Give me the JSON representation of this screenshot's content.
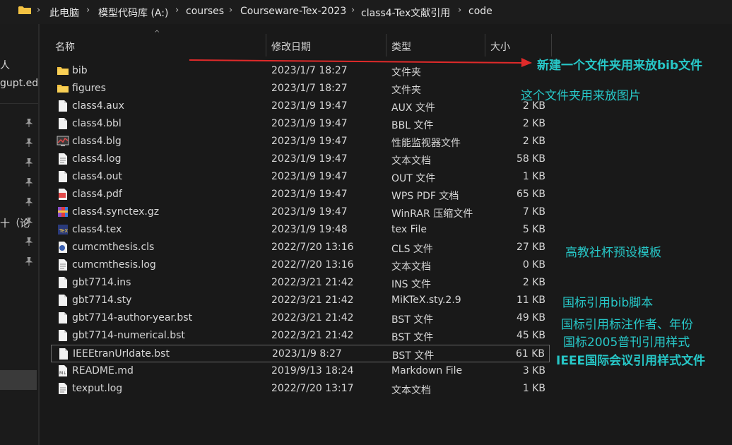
{
  "breadcrumb": [
    "此电脑",
    "模型代码库 (A:)",
    "courses",
    "Courseware-Tex-2023",
    "class4-Tex文献引用",
    "code"
  ],
  "left_pane": {
    "fragments": [
      "人",
      "gupt.edu",
      "十（论"
    ]
  },
  "columns": {
    "name": "名称",
    "date": "修改日期",
    "type": "类型",
    "size": "大小"
  },
  "files": [
    {
      "name": "bib",
      "date": "2023/1/7 18:27",
      "type": "文件夹",
      "size": "",
      "icon": "folder-icon"
    },
    {
      "name": "figures",
      "date": "2023/1/7 18:27",
      "type": "文件夹",
      "size": "",
      "icon": "folder-icon"
    },
    {
      "name": "class4.aux",
      "date": "2023/1/9 19:47",
      "type": "AUX 文件",
      "size": "2 KB",
      "icon": "file-icon"
    },
    {
      "name": "class4.bbl",
      "date": "2023/1/9 19:47",
      "type": "BBL 文件",
      "size": "2 KB",
      "icon": "file-icon"
    },
    {
      "name": "class4.blg",
      "date": "2023/1/9 19:47",
      "type": "性能监视器文件",
      "size": "2 KB",
      "icon": "perfmon-icon"
    },
    {
      "name": "class4.log",
      "date": "2023/1/9 19:47",
      "type": "文本文档",
      "size": "58 KB",
      "icon": "text-file-icon"
    },
    {
      "name": "class4.out",
      "date": "2023/1/9 19:47",
      "type": "OUT 文件",
      "size": "1 KB",
      "icon": "file-icon"
    },
    {
      "name": "class4.pdf",
      "date": "2023/1/9 19:47",
      "type": "WPS PDF 文档",
      "size": "65 KB",
      "icon": "pdf-icon"
    },
    {
      "name": "class4.synctex.gz",
      "date": "2023/1/9 19:47",
      "type": "WinRAR 压缩文件",
      "size": "7 KB",
      "icon": "winrar-icon"
    },
    {
      "name": "class4.tex",
      "date": "2023/1/9 19:48",
      "type": "tex File",
      "size": "5 KB",
      "icon": "tex-icon"
    },
    {
      "name": "cumcmthesis.cls",
      "date": "2022/7/20 13:16",
      "type": "CLS 文件",
      "size": "27 KB",
      "icon": "cls-icon"
    },
    {
      "name": "cumcmthesis.log",
      "date": "2022/7/20 13:16",
      "type": "文本文档",
      "size": "0 KB",
      "icon": "text-file-icon"
    },
    {
      "name": "gbt7714.ins",
      "date": "2022/3/21 21:42",
      "type": "INS 文件",
      "size": "2 KB",
      "icon": "file-icon"
    },
    {
      "name": "gbt7714.sty",
      "date": "2022/3/21 21:42",
      "type": "MiKTeX.sty.2.9",
      "size": "11 KB",
      "icon": "file-icon"
    },
    {
      "name": "gbt7714-author-year.bst",
      "date": "2022/3/21 21:42",
      "type": "BST 文件",
      "size": "49 KB",
      "icon": "file-icon"
    },
    {
      "name": "gbt7714-numerical.bst",
      "date": "2022/3/21 21:42",
      "type": "BST 文件",
      "size": "45 KB",
      "icon": "file-icon"
    },
    {
      "name": "IEEEtranUrldate.bst",
      "date": "2023/1/9 8:27",
      "type": "BST 文件",
      "size": "61 KB",
      "icon": "file-icon",
      "selected": true
    },
    {
      "name": "README.md",
      "date": "2019/9/13 18:24",
      "type": "Markdown File",
      "size": "3 KB",
      "icon": "markdown-icon"
    },
    {
      "name": "texput.log",
      "date": "2022/7/20 13:17",
      "type": "文本文档",
      "size": "1 KB",
      "icon": "text-file-icon"
    }
  ],
  "annotations": {
    "bib_note": "新建一个文件夹用来放bib文件",
    "figures_note": "这个文件夹用来放图片",
    "template_note": "高教社杯预设模板",
    "gbt_sty_note": "国标引用bib脚本",
    "author_year_note": "国标引用标注作者、年份",
    "numerical_note": "国标2005普刊引用样式",
    "ieee_note": "IEEE国际会议引用样式文件"
  },
  "colors": {
    "annotation": "#27c7c7",
    "arrow": "#e02a2a",
    "folder": "#f4c242",
    "background": "#191919"
  }
}
